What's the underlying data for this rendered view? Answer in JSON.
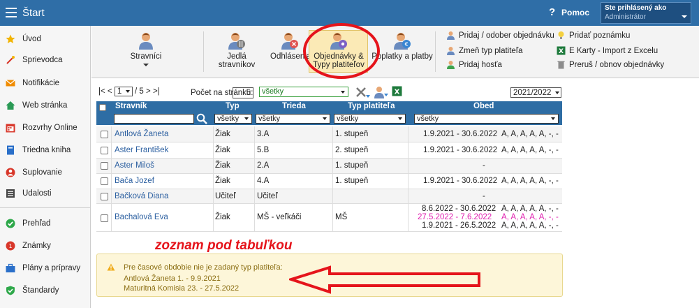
{
  "topbar": {
    "title": "Štart",
    "help_icon": "?",
    "help_label": "Pomoc",
    "user_line": "Ste prihlásený ako",
    "user_role": "Administrátor"
  },
  "sidebar": {
    "items": [
      {
        "label": "Úvod",
        "icon": "star-icon",
        "color": "#f2b400"
      },
      {
        "label": "Sprievodca",
        "icon": "wand-icon",
        "color": "#d8372a"
      },
      {
        "label": "Notifikácie",
        "icon": "envelope-icon",
        "color": "#f08c00"
      },
      {
        "label": "Web stránka",
        "icon": "home-icon",
        "color": "#2a9a55"
      },
      {
        "label": "Rozvrhy Online",
        "icon": "calendar-icon",
        "color": "#d8372a"
      },
      {
        "label": "Triedna kniha",
        "icon": "book-icon",
        "color": "#2a6fc9"
      },
      {
        "label": "Suplovanie",
        "icon": "person-icon",
        "color": "#d8372a"
      },
      {
        "label": "Udalosti",
        "icon": "list-icon",
        "color": "#444444"
      },
      {
        "label": "Prehľad",
        "icon": "check-circle-icon",
        "color": "#2ea84a"
      },
      {
        "label": "Známky",
        "icon": "grade-icon",
        "color": "#d8372a"
      },
      {
        "label": "Plány a prípravy",
        "icon": "briefcase-icon",
        "color": "#2a6fc9"
      },
      {
        "label": "Štandardy",
        "icon": "shield-check-icon",
        "color": "#2ea84a"
      }
    ]
  },
  "toolbar": {
    "stravnici": "Stravníci",
    "jedla": "Jedlá stravníkov",
    "odhlasenia": "Odhlásenia",
    "objednavky_1": "Objednávky &",
    "objednavky_2": "Typy platiteľov",
    "poplatky": "Poplatky a platby",
    "small": [
      "Pridaj / odober objednávku",
      "Zmeň typ platiteľa",
      "Pridaj hosťa",
      "Pridať poznámku",
      "E Karty - Import z Excelu",
      "Preruš / obnov objednávky"
    ]
  },
  "pager": {
    "first": "|<",
    "prev": "<",
    "page": "1",
    "of": "/ 5",
    "next": ">",
    "last": ">|",
    "perpage_label": "Počet na stránku:",
    "perpage": "5",
    "filter": "všetky",
    "year": "2021/2022"
  },
  "table": {
    "headers": {
      "name": "Stravník",
      "type": "Typ",
      "class": "Trieda",
      "payer": "Typ platiteľa",
      "meal": "Obed"
    },
    "filters": {
      "type": "všetky",
      "class": "všetky",
      "payer": "všetky",
      "meal": "všetky"
    },
    "rows": [
      {
        "name": "Antlová Žaneta",
        "type": "Žiak",
        "class": "3.A",
        "payer": "1. stupeň",
        "periods": [
          {
            "date": "1.9.2021 - 30.6.2022",
            "meals": "A, A, A, A, A, -, -"
          }
        ]
      },
      {
        "name": "Aster František",
        "type": "Žiak",
        "class": "5.B",
        "payer": "2. stupeň",
        "periods": [
          {
            "date": "1.9.2021 - 30.6.2022",
            "meals": "A, A, A, A, A, -, -"
          }
        ]
      },
      {
        "name": "Aster Miloš",
        "type": "Žiak",
        "class": "2.A",
        "payer": "1. stupeň",
        "periods": [
          {
            "date": "-",
            "meals": ""
          }
        ]
      },
      {
        "name": "Bača Jozef",
        "type": "Žiak",
        "class": "4.A",
        "payer": "1. stupeň",
        "periods": [
          {
            "date": "1.9.2021 - 30.6.2022",
            "meals": "A, A, A, A, A, -, -"
          }
        ]
      },
      {
        "name": "Bačková Diana",
        "type": "Učiteľ",
        "class": "Učiteľ",
        "payer": "",
        "periods": [
          {
            "date": "-",
            "meals": ""
          }
        ]
      },
      {
        "name": "Bachalová Eva",
        "type": "Žiak",
        "class": "MŠ - veľkáči",
        "payer": "MŠ",
        "periods": [
          {
            "date": "8.6.2022 - 30.6.2022",
            "meals": "A, A, A, A, A, -, -"
          },
          {
            "date": "27.5.2022 - 7.6.2022",
            "meals": "A, A, A, A, A, -, -",
            "highlight": true
          },
          {
            "date": "1.9.2021 - 26.5.2022",
            "meals": "A, A, A, A, A, -, -"
          }
        ]
      }
    ]
  },
  "annotation": "zoznam pod tabuľkou",
  "warning": {
    "title": "Pre časové obdobie nie je zadaný typ platiteľa:",
    "lines": [
      "Antlová Žaneta 1. - 9.9.2021",
      "Maturitná Komisia 23. - 27.5.2022"
    ]
  },
  "colors": {
    "header": "#2f6ea7",
    "accent_red": "#e5141b",
    "link": "#2b5fa0",
    "highlight": "#e020b0"
  }
}
